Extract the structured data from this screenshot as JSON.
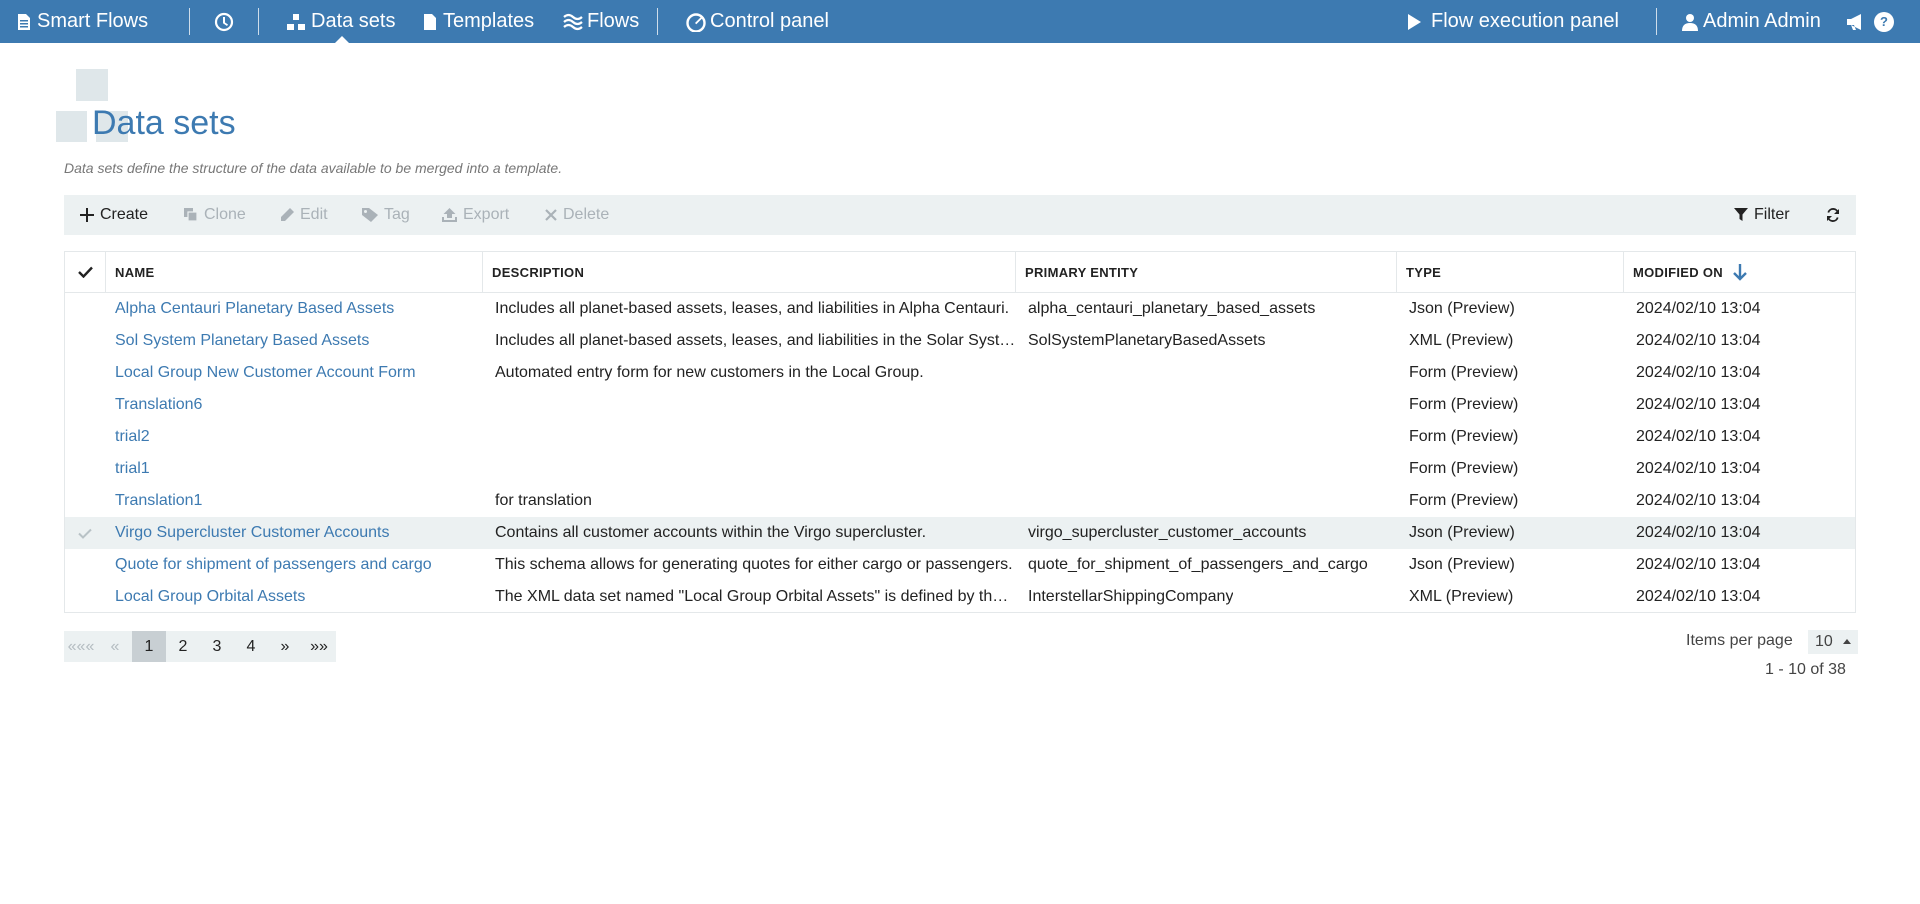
{
  "nav": {
    "brand": "Smart Flows",
    "data_sets": "Data sets",
    "templates": "Templates",
    "flows": "Flows",
    "control_panel": "Control panel",
    "flow_execution": "Flow execution panel",
    "user": "Admin Admin",
    "help": "?"
  },
  "page": {
    "title": "Data sets",
    "description": "Data sets define the structure of the data available to be merged into a template."
  },
  "toolbar": {
    "create": "Create",
    "clone": "Clone",
    "edit": "Edit",
    "tag": "Tag",
    "export": "Export",
    "delete": "Delete",
    "filter": "Filter"
  },
  "table": {
    "columns": [
      "NAME",
      "DESCRIPTION",
      "PRIMARY ENTITY",
      "TYPE",
      "MODIFIED ON"
    ],
    "rows": [
      {
        "name": "Alpha Centauri Planetary Based Assets",
        "description": "Includes all planet-based assets, leases, and liabilities in Alpha Centauri.",
        "entity": "alpha_centauri_planetary_based_assets",
        "type": "Json (Preview)",
        "modified": "2024/02/10 13:04",
        "selected": false
      },
      {
        "name": "Sol System Planetary Based Assets",
        "description": "Includes all planet-based assets, leases, and liabilities in the Solar System.",
        "entity": "SolSystemPlanetaryBasedAssets",
        "type": "XML (Preview)",
        "modified": "2024/02/10 13:04",
        "selected": false
      },
      {
        "name": "Local Group New Customer Account Form",
        "description": "Automated entry form for new customers in the Local Group.",
        "entity": "",
        "type": "Form (Preview)",
        "modified": "2024/02/10 13:04",
        "selected": false
      },
      {
        "name": "Translation6",
        "description": "",
        "entity": "",
        "type": "Form (Preview)",
        "modified": "2024/02/10 13:04",
        "selected": false
      },
      {
        "name": "trial2",
        "description": "",
        "entity": "",
        "type": "Form (Preview)",
        "modified": "2024/02/10 13:04",
        "selected": false
      },
      {
        "name": "trial1",
        "description": "",
        "entity": "",
        "type": "Form (Preview)",
        "modified": "2024/02/10 13:04",
        "selected": false
      },
      {
        "name": "Translation1",
        "description": "for translation",
        "entity": "",
        "type": "Form (Preview)",
        "modified": "2024/02/10 13:04",
        "selected": false
      },
      {
        "name": "Virgo Supercluster Customer Accounts",
        "description": "Contains all customer accounts within the Virgo supercluster.",
        "entity": "virgo_supercluster_customer_accounts",
        "type": "Json (Preview)",
        "modified": "2024/02/10 13:04",
        "selected": true
      },
      {
        "name": "Quote for shipment of passengers and cargo",
        "description": "This schema allows for generating quotes for either cargo or passengers.",
        "entity": "quote_for_shipment_of_passengers_and_cargo",
        "type": "Json (Preview)",
        "modified": "2024/02/10 13:04",
        "selected": false
      },
      {
        "name": "Local Group Orbital Assets",
        "description": "The XML data set named \"Local Group Orbital Assets\" is defined by the company.",
        "entity": "InterstellarShippingCompany",
        "type": "XML (Preview)",
        "modified": "2024/02/10 13:04",
        "selected": false
      }
    ]
  },
  "pager": {
    "first": "«««",
    "prev": "«",
    "pages": [
      "1",
      "2",
      "3",
      "4"
    ],
    "current": "1",
    "next": "»",
    "last": "»»",
    "items_per_page_label": "Items per page",
    "items_per_page": "10",
    "range": "1 - 10 of 38"
  },
  "colors": {
    "topbar": "#3d7ab1",
    "link": "#3d7ab1",
    "toolbar_bg": "#ecf1f2"
  }
}
